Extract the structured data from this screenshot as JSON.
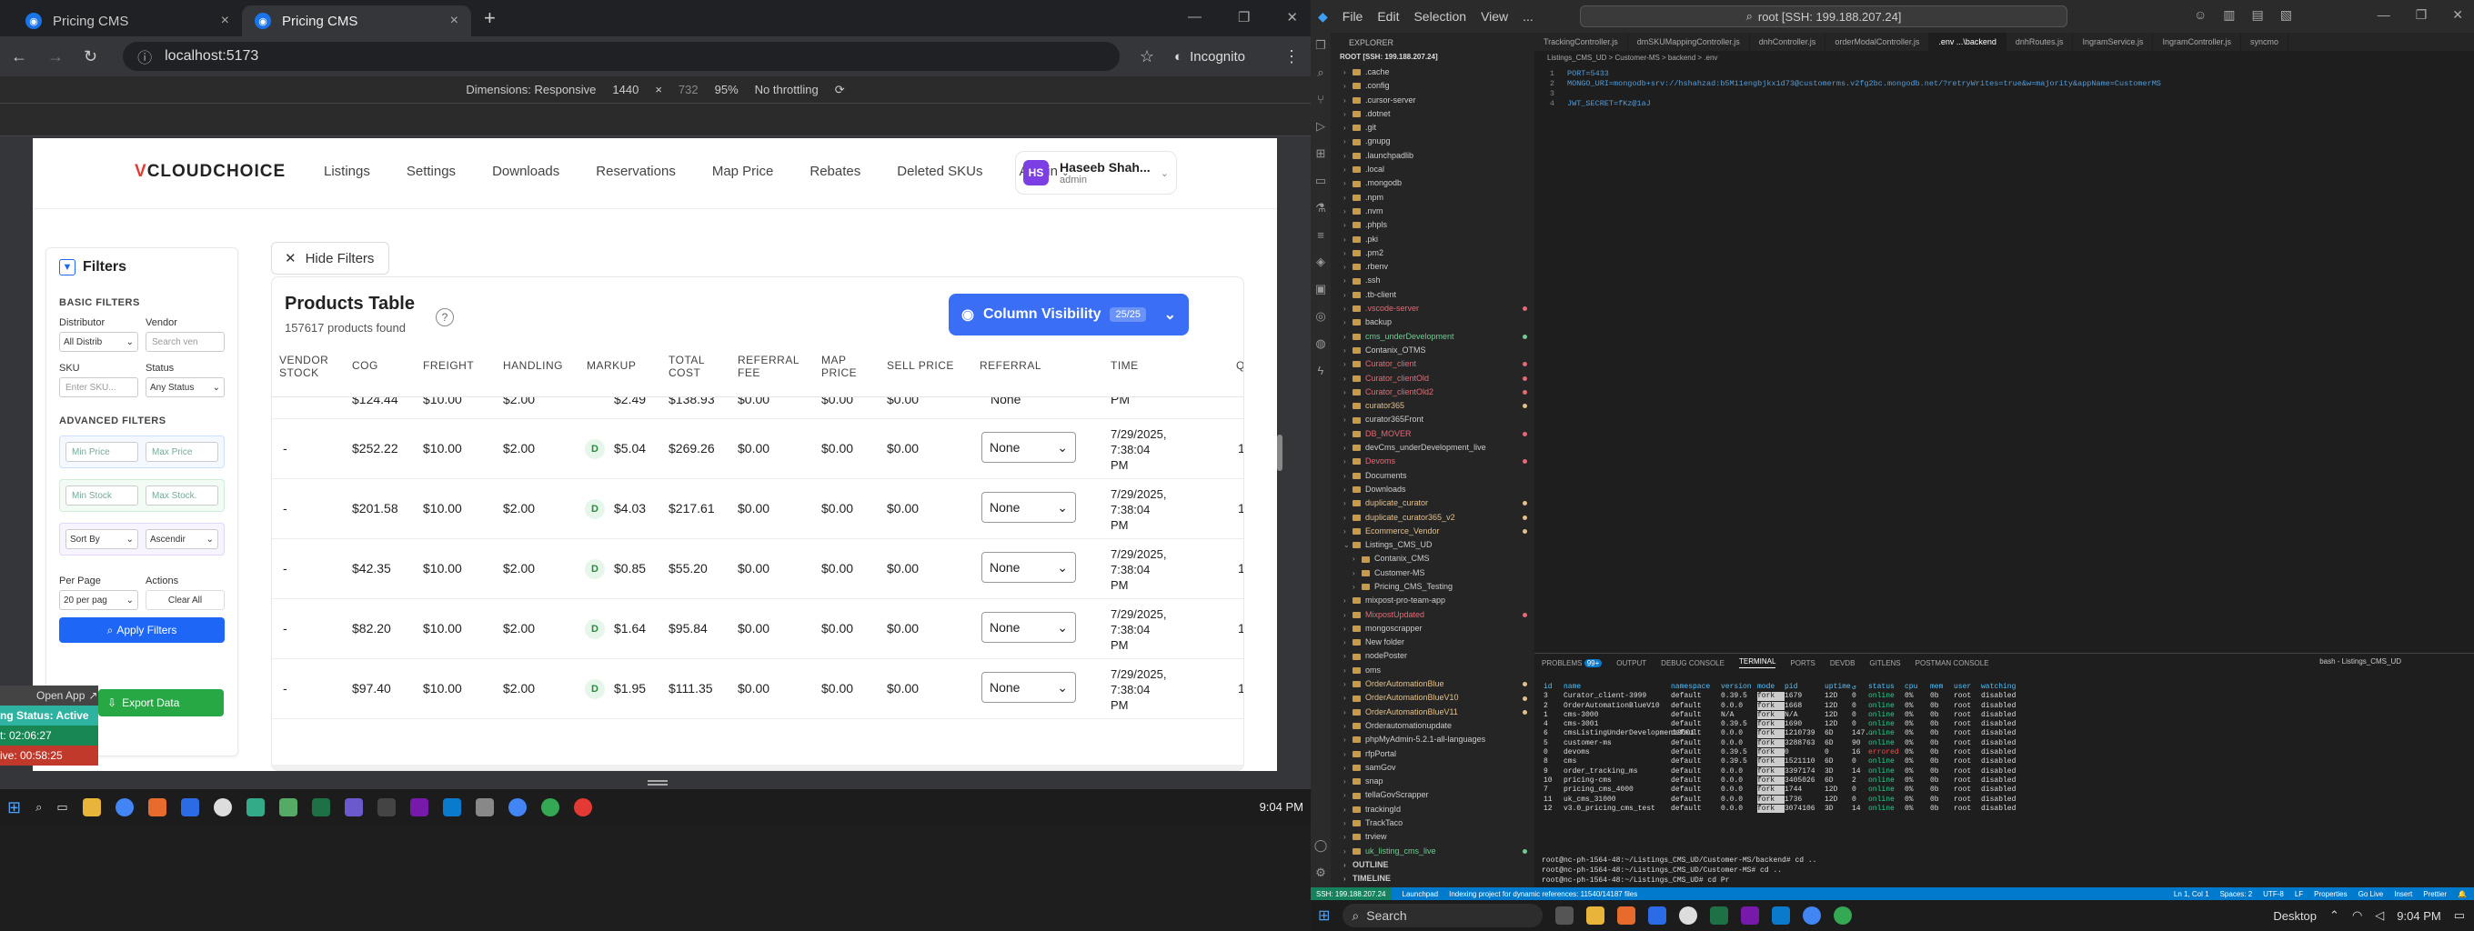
{
  "browser": {
    "tabs": [
      {
        "title": "Pricing CMS"
      },
      {
        "title": "Pricing CMS"
      }
    ],
    "url": "localhost:5173",
    "incognito": "Incognito",
    "devtools": {
      "dimensions": "Dimensions: Responsive",
      "width": "1440",
      "height": "732",
      "zoom": "95%",
      "throttle": "No throttling"
    }
  },
  "app": {
    "logo": "CLOUDCHOICE",
    "nav": [
      "Listings",
      "Settings",
      "Downloads",
      "Reservations",
      "Map Price",
      "Rebates",
      "Deleted SKUs",
      "Admin"
    ],
    "user": {
      "initials": "HS",
      "name": "Haseeb Shah...",
      "role": "admin"
    },
    "hide_filters": "Hide Filters",
    "filters": {
      "title": "Filters",
      "basic": "BASIC FILTERS",
      "distributor_label": "Distributor",
      "distributor_value": "All Distrib",
      "vendor_label": "Vendor",
      "vendor_placeholder": "Search ven",
      "sku_label": "SKU",
      "sku_placeholder": "Enter SKU...",
      "status_label": "Status",
      "status_value": "Any Status",
      "advanced": "ADVANCED FILTERS",
      "min_price": "Min Price",
      "max_price": "Max Price",
      "min_stock": "Min Stock",
      "max_stock": "Max Stock.",
      "sort_by": "Sort By",
      "sort_order": "Ascendir",
      "per_page_label": "Per Page",
      "per_page_value": "20 per pag",
      "actions_label": "Actions",
      "clear_all": "Clear All",
      "apply": "Apply Filters",
      "export": "Export Data"
    },
    "table": {
      "title": "Products Table",
      "subtitle": "157617 products found",
      "column_visibility": "Column Visibility",
      "column_count": "25/25",
      "headers": [
        "VENDOR STOCK",
        "COG",
        "FREIGHT",
        "HANDLING",
        "MARKUP",
        "TOTAL COST",
        "REFERRAL FEE",
        "MAP PRICE",
        "SELL PRICE",
        "REFERRAL",
        "TIME",
        "Q"
      ],
      "top_partial": {
        "cog": "$124.44",
        "freight": "$10.00",
        "handling": "$2.00",
        "markup": "$2.49",
        "total": "$138.93",
        "ref": "$0.00",
        "map": "$0.00",
        "sell": "$0.00",
        "referral": "None",
        "time": "PM"
      },
      "rows": [
        {
          "stock": "-",
          "cog": "$252.22",
          "freight": "$10.00",
          "handling": "$2.00",
          "markup_badge": "D",
          "markup": "$5.04",
          "total": "$269.26",
          "ref": "$0.00",
          "map": "$0.00",
          "sell": "$0.00",
          "referral": "None",
          "time1": "7/29/2025,",
          "time2": "7:38:04",
          "time3": "PM",
          "q": "1"
        },
        {
          "stock": "-",
          "cog": "$201.58",
          "freight": "$10.00",
          "handling": "$2.00",
          "markup_badge": "D",
          "markup": "$4.03",
          "total": "$217.61",
          "ref": "$0.00",
          "map": "$0.00",
          "sell": "$0.00",
          "referral": "None",
          "time1": "7/29/2025,",
          "time2": "7:38:04",
          "time3": "PM",
          "q": "1"
        },
        {
          "stock": "-",
          "cog": "$42.35",
          "freight": "$10.00",
          "handling": "$2.00",
          "markup_badge": "D",
          "markup": "$0.85",
          "total": "$55.20",
          "ref": "$0.00",
          "map": "$0.00",
          "sell": "$0.00",
          "referral": "None",
          "time1": "7/29/2025,",
          "time2": "7:38:04",
          "time3": "PM",
          "q": "1"
        },
        {
          "stock": "-",
          "cog": "$82.20",
          "freight": "$10.00",
          "handling": "$2.00",
          "markup_badge": "D",
          "markup": "$1.64",
          "total": "$95.84",
          "ref": "$0.00",
          "map": "$0.00",
          "sell": "$0.00",
          "referral": "None",
          "time1": "7/29/2025,",
          "time2": "7:38:04",
          "time3": "PM",
          "q": "1"
        },
        {
          "stock": "-",
          "cog": "$97.40",
          "freight": "$10.00",
          "handling": "$2.00",
          "markup_badge": "D",
          "markup": "$1.95",
          "total": "$111.35",
          "ref": "$0.00",
          "map": "$0.00",
          "sell": "$0.00",
          "referral": "None",
          "time1": "7/29/2025,",
          "time2": "7:38:04",
          "time3": "PM",
          "q": "1"
        }
      ]
    }
  },
  "overlay": {
    "open_app": "Open App",
    "status": "ng Status: Active",
    "timer1": "t: 02:06:27",
    "timer2": "ive: 00:58:25"
  },
  "taskbar_left": {
    "time": "9:04 PM"
  },
  "vscode": {
    "menu": [
      "File",
      "Edit",
      "Selection",
      "View",
      "..."
    ],
    "search": "root [SSH: 199.188.207.24]",
    "explorer_title": "EXPLORER",
    "root": "ROOT [SSH: 199.188.207.24]",
    "files": [
      ".cache",
      ".config",
      ".cursor-server",
      ".dotnet",
      ".git",
      ".gnupg",
      ".launchpadlib",
      ".local",
      ".mongodb",
      ".npm",
      ".nvm",
      ".phpls",
      ".pki",
      ".pm2",
      ".rbenv",
      ".ssh",
      ".tb-client",
      ".vscode-server",
      "backup",
      "cms_underDevelopment",
      "Contanix_OTMS",
      "Curator_client",
      "Curator_clientOld",
      "Curator_clientOld2",
      "curator365",
      "curator365Front",
      "DB_MOVER",
      "devCms_underDevelopment_live",
      "Devoms",
      "Documents",
      "Downloads",
      "duplicate_curator",
      "duplicate_curator365_v2",
      "Ecommerce_Vendor",
      "Listings_CMS_UD",
      "Contanix_CMS",
      "Customer-MS",
      "Pricing_CMS_Testing",
      "mixpost-pro-team-app",
      "MixpostUpdated",
      "mongoscrapper",
      "New folder",
      "nodePoster",
      "oms",
      "OrderAutomationBlue",
      "OrderAutomationBlueV10",
      "OrderAutomationBlueV11",
      "Orderautomationupdate",
      "phpMyAdmin-5.2.1-all-languages",
      "rfpPortal",
      "samGov",
      "snap",
      "tellaGovScrapper",
      "trackingId",
      "TrackTaco",
      "trview",
      "uk_listing_cms_live"
    ],
    "outline": "OUTLINE",
    "timeline": "TIMELINE",
    "tabs": [
      "TrackingController.js",
      "dmSKUMappingController.js",
      "dnhController.js",
      "orderModalController.js",
      ".env ...\\backend",
      "dnhRoutes.js",
      "IngramService.js",
      "IngramController.js",
      "syncmo"
    ],
    "breadcrumb": "Listings_CMS_UD > Customer-MS > backend > .env",
    "code": [
      {
        "n": "1",
        "t": "PORT=5433"
      },
      {
        "n": "2",
        "t": "MONGO_URI=mongodb+srv://hshahzad:b5M11engbjkx1d73@customerms.v2fg2bc.mongodb.net/?retryWrites=true&w=majority&appName=CustomerMS"
      },
      {
        "n": "3",
        "t": ""
      },
      {
        "n": "4",
        "t": "JWT_SECRET=fKz@1aJ"
      }
    ],
    "panel_tabs": [
      "PROBLEMS",
      "OUTPUT",
      "DEBUG CONSOLE",
      "TERMINAL",
      "PORTS",
      "DEVDB",
      "GITLENS",
      "POSTMAN CONSOLE"
    ],
    "problems_count": "99+",
    "terminal_title": "bash - Listings_CMS_UD",
    "pm2_headers": [
      "id",
      "name",
      "namespace",
      "version",
      "mode",
      "pid",
      "uptime",
      "↺",
      "status",
      "cpu",
      "mem",
      "user",
      "watching"
    ],
    "pm2_rows": [
      [
        "3",
        "Curator_client-3999",
        "default",
        "0.39.5",
        "fork",
        "1679",
        "12D",
        "0",
        "online",
        "0%",
        "0b",
        "root",
        "disabled"
      ],
      [
        "2",
        "OrderAutomationBlueV10",
        "default",
        "0.0.0",
        "fork",
        "1668",
        "12D",
        "0",
        "online",
        "0%",
        "0b",
        "root",
        "disabled"
      ],
      [
        "1",
        "cms-3000",
        "default",
        "N/A",
        "fork",
        "N/A",
        "12D",
        "0",
        "online",
        "0%",
        "0b",
        "root",
        "disabled"
      ],
      [
        "4",
        "cms-3001",
        "default",
        "0.39.5",
        "fork",
        "1690",
        "12D",
        "0",
        "online",
        "0%",
        "0b",
        "root",
        "disabled"
      ],
      [
        "6",
        "cmsListingUnderDevelopment3001",
        "default",
        "0.0.0",
        "fork",
        "1210739",
        "6D",
        "147..",
        "online",
        "0%",
        "0b",
        "root",
        "disabled"
      ],
      [
        "5",
        "customer-ms",
        "default",
        "0.0.0",
        "fork",
        "3288763",
        "6D",
        "90",
        "online",
        "0%",
        "0b",
        "root",
        "disabled"
      ],
      [
        "0",
        "devoms",
        "default",
        "0.39.5",
        "fork",
        "0",
        "0",
        "16",
        "errored",
        "0%",
        "0b",
        "root",
        "disabled"
      ],
      [
        "8",
        "cms",
        "default",
        "0.39.5",
        "fork",
        "1521110",
        "6D",
        "0",
        "online",
        "0%",
        "0b",
        "root",
        "disabled"
      ],
      [
        "9",
        "order_tracking_ms",
        "default",
        "0.0.0",
        "fork",
        "3397174",
        "3D",
        "14",
        "online",
        "0%",
        "0b",
        "root",
        "disabled"
      ],
      [
        "10",
        "pricing-cms",
        "default",
        "0.0.0",
        "fork",
        "3405026",
        "6D",
        "2",
        "online",
        "0%",
        "0b",
        "root",
        "disabled"
      ],
      [
        "7",
        "pricing_cms_4000",
        "default",
        "0.0.0",
        "fork",
        "1744",
        "12D",
        "0",
        "online",
        "0%",
        "0b",
        "root",
        "disabled"
      ],
      [
        "11",
        "uk_cms_31000",
        "default",
        "0.0.0",
        "fork",
        "1736",
        "12D",
        "0",
        "online",
        "0%",
        "0b",
        "root",
        "disabled"
      ],
      [
        "12",
        "v3.0_pricing_cms_test",
        "default",
        "0.0.0",
        "fork",
        "3074106",
        "3D",
        "14",
        "online",
        "0%",
        "0b",
        "root",
        "disabled"
      ]
    ],
    "term_lines": [
      "root@nc-ph-1564-48:~/Listings_CMS_UD/Customer-MS/backend# cd ..",
      "root@nc-ph-1564-48:~/Listings_CMS_UD/Customer-MS# cd ..",
      "root@nc-ph-1564-48:~/Listings_CMS_UD# cd Pr"
    ],
    "status": {
      "ssh": "SSH: 199.188.207.24",
      "left": "Launchpad",
      "indexing": "Indexing project for dynamic references: 11540/14187 files",
      "pos": "Ln 1, Col 1",
      "spaces": "Spaces: 2",
      "enc": "UTF-8",
      "eol": "LF",
      "lang": "Properties",
      "golive": "Go Live",
      "insert": "Insert",
      "prettier": "Prettier"
    },
    "taskbar": {
      "search": "Search",
      "desktop": "Desktop",
      "time": "9:04 PM"
    }
  }
}
